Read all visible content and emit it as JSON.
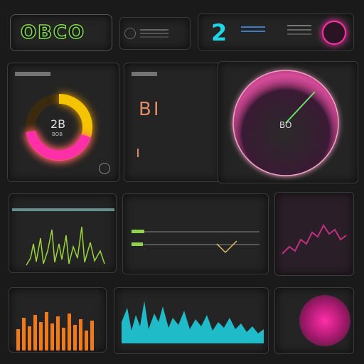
{
  "header": {
    "logo_text": "OBCO",
    "badge_number": "2"
  },
  "colors": {
    "yellow": "#f5c400",
    "magenta": "#ff2fa8",
    "cyan": "#1fd6e6",
    "green": "#9bd43a",
    "orange": "#f07a1a",
    "pink_ring": "#f2a3c4"
  },
  "icons": {
    "settings": "gear-icon",
    "profile": "avatar-icon",
    "expand": "expand-icon"
  },
  "top_row": {
    "donut_label": "BOB",
    "donut_value": "2B",
    "compass_label": "BO",
    "bigreadout_value": "BI"
  }
}
